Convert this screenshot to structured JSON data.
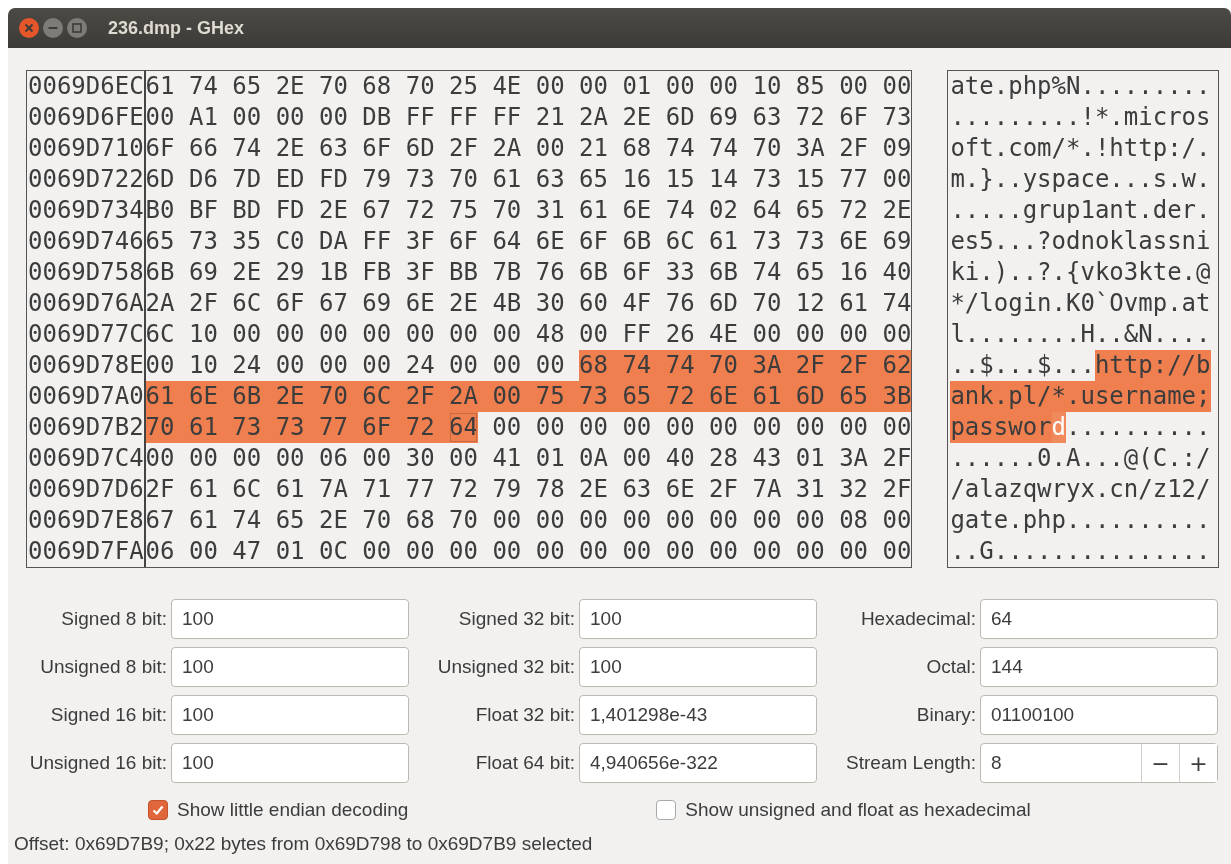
{
  "window": {
    "title": "236.dmp - GHex"
  },
  "hex_rows": [
    {
      "offset": "0069D6EC",
      "hex": [
        {
          "text": "61 74 65 2E 70 68 70 25 4E 00 00 01 00 00 10 85 00 00",
          "selected": false,
          "cursor": false
        }
      ],
      "ascii": [
        {
          "text": "ate.php%N.........",
          "selected": false,
          "cursor": false
        }
      ]
    },
    {
      "offset": "0069D6FE",
      "hex": [
        {
          "text": "00 A1 00 00 00 DB FF FF FF 21 2A 2E 6D 69 63 72 6F 73",
          "selected": false,
          "cursor": false
        }
      ],
      "ascii": [
        {
          "text": ".........!*.micros",
          "selected": false,
          "cursor": false
        }
      ]
    },
    {
      "offset": "0069D710",
      "hex": [
        {
          "text": "6F 66 74 2E 63 6F 6D 2F 2A 00 21 68 74 74 70 3A 2F 09",
          "selected": false,
          "cursor": false
        }
      ],
      "ascii": [
        {
          "text": "oft.com/*.!http:/.",
          "selected": false,
          "cursor": false
        }
      ]
    },
    {
      "offset": "0069D722",
      "hex": [
        {
          "text": "6D D6 7D ED FD 79 73 70 61 63 65 16 15 14 73 15 77 00",
          "selected": false,
          "cursor": false
        }
      ],
      "ascii": [
        {
          "text": "m.}..yspace...s.w.",
          "selected": false,
          "cursor": false
        }
      ]
    },
    {
      "offset": "0069D734",
      "hex": [
        {
          "text": "B0 BF BD FD 2E 67 72 75 70 31 61 6E 74 02 64 65 72 2E",
          "selected": false,
          "cursor": false
        }
      ],
      "ascii": [
        {
          "text": ".....grup1ant.der.",
          "selected": false,
          "cursor": false
        }
      ]
    },
    {
      "offset": "0069D746",
      "hex": [
        {
          "text": "65 73 35 C0 DA FF 3F 6F 64 6E 6F 6B 6C 61 73 73 6E 69",
          "selected": false,
          "cursor": false
        }
      ],
      "ascii": [
        {
          "text": "es5...?odnoklassni",
          "selected": false,
          "cursor": false
        }
      ]
    },
    {
      "offset": "0069D758",
      "hex": [
        {
          "text": "6B 69 2E 29 1B FB 3F BB 7B 76 6B 6F 33 6B 74 65 16 40",
          "selected": false,
          "cursor": false
        }
      ],
      "ascii": [
        {
          "text": "ki.)..?.{vko3kte.@",
          "selected": false,
          "cursor": false
        }
      ]
    },
    {
      "offset": "0069D76A",
      "hex": [
        {
          "text": "2A 2F 6C 6F 67 69 6E 2E 4B 30 60 4F 76 6D 70 12 61 74",
          "selected": false,
          "cursor": false
        }
      ],
      "ascii": [
        {
          "text": "*/login.K0`Ovmp.at",
          "selected": false,
          "cursor": false
        }
      ]
    },
    {
      "offset": "0069D77C",
      "hex": [
        {
          "text": "6C 10 00 00 00 00 00 00 00 48 00 FF 26 4E 00 00 00 00",
          "selected": false,
          "cursor": false
        }
      ],
      "ascii": [
        {
          "text": "l........H..&N....",
          "selected": false,
          "cursor": false
        }
      ]
    },
    {
      "offset": "0069D78E",
      "hex": [
        {
          "text": "00 10 24 00 00 00 24 00 00 00",
          "selected": false,
          "cursor": false
        },
        {
          "text": "68 74 74 70 3A 2F 2F 62",
          "selected": true,
          "cursor": false
        }
      ],
      "ascii": [
        {
          "text": "..$...$...",
          "selected": false,
          "cursor": false
        },
        {
          "text": "http://b",
          "selected": true,
          "cursor": false
        }
      ]
    },
    {
      "offset": "0069D7A0",
      "hex": [
        {
          "text": "61 6E 6B 2E 70 6C 2F 2A 00 75 73 65 72 6E 61 6D 65 3B",
          "selected": true,
          "cursor": false
        }
      ],
      "ascii": [
        {
          "text": "ank.pl/*.username;",
          "selected": true,
          "cursor": false
        }
      ]
    },
    {
      "offset": "0069D7B2",
      "hex": [
        {
          "text": "70 61 73 73 77 6F 72",
          "selected": true,
          "cursor": false
        },
        {
          "text": "64",
          "selected": true,
          "cursor": true
        },
        {
          "text": "00 00 00 00 00 00 00 00 00 00",
          "selected": false,
          "cursor": false
        }
      ],
      "ascii": [
        {
          "text": "passwor",
          "selected": true,
          "cursor": false
        },
        {
          "text": "d",
          "selected": true,
          "cursor": true
        },
        {
          "text": "..........",
          "selected": false,
          "cursor": false
        }
      ]
    },
    {
      "offset": "0069D7C4",
      "hex": [
        {
          "text": "00 00 00 00 06 00 30 00 41 01 0A 00 40 28 43 01 3A 2F",
          "selected": false,
          "cursor": false
        }
      ],
      "ascii": [
        {
          "text": "......0.A...@(C.:/",
          "selected": false,
          "cursor": false
        }
      ]
    },
    {
      "offset": "0069D7D6",
      "hex": [
        {
          "text": "2F 61 6C 61 7A 71 77 72 79 78 2E 63 6E 2F 7A 31 32 2F",
          "selected": false,
          "cursor": false
        }
      ],
      "ascii": [
        {
          "text": "/alazqwryx.cn/z12/",
          "selected": false,
          "cursor": false
        }
      ]
    },
    {
      "offset": "0069D7E8",
      "hex": [
        {
          "text": "67 61 74 65 2E 70 68 70 00 00 00 00 00 00 00 00 08 00",
          "selected": false,
          "cursor": false
        }
      ],
      "ascii": [
        {
          "text": "gate.php..........",
          "selected": false,
          "cursor": false
        }
      ]
    },
    {
      "offset": "0069D7FA",
      "hex": [
        {
          "text": "06 00 47 01 0C 00 00 00 00 00 00 00 00 00 00 00 00 00",
          "selected": false,
          "cursor": false
        }
      ],
      "ascii": [
        {
          "text": "..G...............",
          "selected": false,
          "cursor": false
        }
      ]
    }
  ],
  "fields": [
    {
      "kind": "text",
      "label": "Signed 8 bit:",
      "value": "100"
    },
    {
      "kind": "text",
      "label": "Signed 32 bit:",
      "value": "100"
    },
    {
      "kind": "text",
      "label": "Hexadecimal:",
      "value": "64"
    },
    {
      "kind": "text",
      "label": "Unsigned 8 bit:",
      "value": "100"
    },
    {
      "kind": "text",
      "label": "Unsigned 32 bit:",
      "value": "100"
    },
    {
      "kind": "text",
      "label": "Octal:",
      "value": "144"
    },
    {
      "kind": "text",
      "label": "Signed 16 bit:",
      "value": "100"
    },
    {
      "kind": "text",
      "label": "Float 32 bit:",
      "value": "1,401298e-43"
    },
    {
      "kind": "text",
      "label": "Binary:",
      "value": "01100100"
    },
    {
      "kind": "text",
      "label": "Unsigned 16 bit:",
      "value": "100"
    },
    {
      "kind": "text",
      "label": "Float 64 bit:",
      "value": "4,940656e-322"
    },
    {
      "kind": "spin",
      "label": "Stream Length:",
      "value": "8",
      "decrement": "−",
      "increment": "+"
    }
  ],
  "checkboxes": [
    {
      "label": "Show little endian decoding",
      "checked": true
    },
    {
      "label": "Show unsigned and float as hexadecimal",
      "checked": false
    }
  ],
  "status_bar": "Offset: 0x69D7B9; 0x22 bytes from 0x69D798 to 0x69D7B9 selected"
}
